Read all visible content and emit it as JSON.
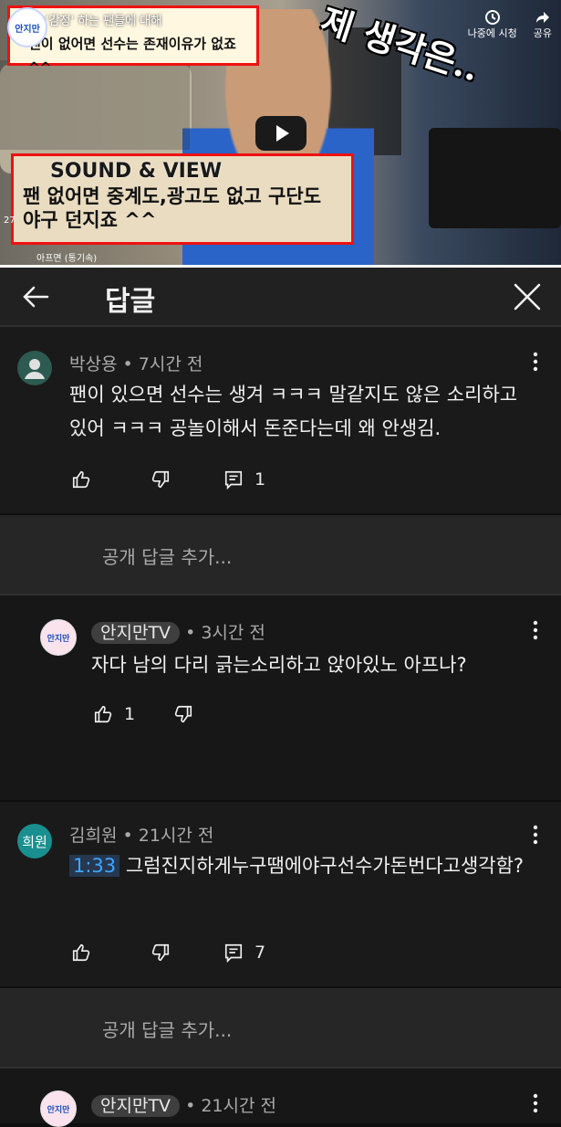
{
  "video": {
    "channel_logo_text": "안지만",
    "caption_top_title": "'감정' 하는 팬들에 대해",
    "caption_top_text": "팬이 없어면 선수는 존재이유가 없죠 ^^",
    "caption_bottom_head": "SOUND & VIEW",
    "caption_bottom_text": "팬 없어면 중계도,광고도 없고 구단도 야구 던지죠 ^^",
    "caption_top_head": "SOUND & VIEW",
    "overlay_text": "제 생각은..",
    "share_label": "공유",
    "viewers_label": "나중에 시청",
    "side_count": "27",
    "bottom_info": "아프면 (통기속)"
  },
  "header": {
    "title": "답글"
  },
  "comments": [
    {
      "author": "박상용",
      "time": "• 7시간 전",
      "text": "팬이 있으면 선수는 생겨 ㅋㅋㅋ 말같지도 않은 소리하고 있어 ㅋㅋㅋ 공놀이해서 돈준다는데 왜 안생김.",
      "like_count": "",
      "reply_count": "1"
    },
    {
      "author": "안지만TV",
      "time": "• 3시간 전",
      "text": "자다 남의 다리 긁는소리하고 앉아있노 아프나?",
      "like_count": "1",
      "avatar_text": "안지만"
    },
    {
      "author": "김희원",
      "avatar_text": "희원",
      "time": "• 21시간 전",
      "timestamp": "1:33",
      "text": "그럼진지하게누구땜에야구선수가돈번다고생각함?",
      "like_count": "",
      "reply_count": "7"
    },
    {
      "author": "안지만TV",
      "time": "• 21시간 전",
      "avatar_text": "안지만"
    }
  ],
  "add_reply_placeholder": "공개 답글 추가...",
  "colors": {
    "background": "#0f0f0f",
    "card": "#1a1a1a",
    "link_blue": "#3ea6ff",
    "avatar_teal": "#1a8f8f"
  }
}
